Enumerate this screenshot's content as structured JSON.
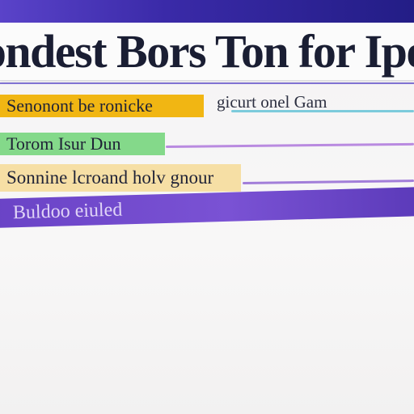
{
  "header": {
    "title": "Iondest Bors Ton for Ipor"
  },
  "rows": [
    {
      "label": "Senonont be ronicke",
      "side_text": "gicurt onel Gam",
      "accent": "#f1b613",
      "line": "#7ccbdc"
    },
    {
      "label": "Torom Isur Dun",
      "accent": "#84d98a",
      "line": "#b98ae0"
    },
    {
      "label": "Sonnine lcroand holv gnour",
      "accent": "#f6dfa5",
      "line": "#a27ed9"
    },
    {
      "label": "Buldoo eiuled",
      "accent": "#6a43c6",
      "line": "#6a43c6"
    }
  ]
}
